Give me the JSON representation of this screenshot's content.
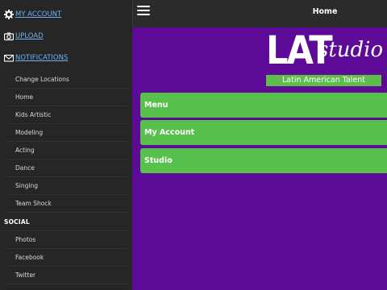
{
  "sidebar": {
    "top_links": [
      {
        "label": "MY ACCOUNT",
        "icon": "gear-icon"
      },
      {
        "label": "UPLOAD",
        "icon": "camera-icon"
      },
      {
        "label": "NOTIFICATIONS",
        "icon": "envelope-icon"
      }
    ],
    "items": [
      {
        "label": "Change Locations"
      },
      {
        "label": "Home"
      },
      {
        "label": "Kids Artistic"
      },
      {
        "label": "Modeling"
      },
      {
        "label": "Acting"
      },
      {
        "label": "Dance"
      },
      {
        "label": "Singing"
      },
      {
        "label": "Team Shock"
      }
    ],
    "social_heading": "SOCIAL",
    "social_items": [
      {
        "label": "Photos"
      },
      {
        "label": "Facebook"
      },
      {
        "label": "Twitter"
      }
    ]
  },
  "header": {
    "title": "Home"
  },
  "logo": {
    "main": "LAT",
    "script": "studio",
    "tagline": "Latin American Talent"
  },
  "buttons": [
    {
      "label": "Menu"
    },
    {
      "label": "My Account"
    },
    {
      "label": "Studio"
    }
  ],
  "colors": {
    "purple": "#5d0b96",
    "green": "#58c04d",
    "link": "#6fb1f2"
  }
}
